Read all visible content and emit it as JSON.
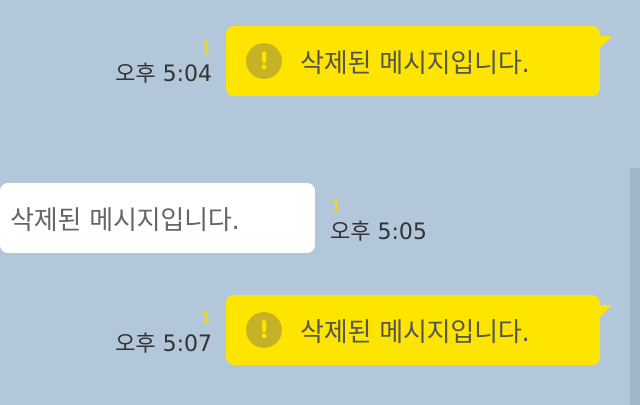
{
  "messages": [
    {
      "side": "mine",
      "icon": "exclamation-icon",
      "text": "삭제된 메시지입니다.",
      "unread_count": "1",
      "time": "오후 5:04"
    },
    {
      "side": "theirs",
      "text": "삭제된 메시지입니다.",
      "unread_count": "1",
      "time": "오후 5:05"
    },
    {
      "side": "mine",
      "icon": "exclamation-icon",
      "text": "삭제된 메시지입니다.",
      "unread_count": "1",
      "time": "오후 5:07"
    }
  ],
  "colors": {
    "background": "#b2c7d9",
    "my_bubble": "#fee500",
    "their_bubble": "#ffffff",
    "unread": "#f5d90a",
    "icon": "#c6b225"
  },
  "icon_glyph": "!"
}
